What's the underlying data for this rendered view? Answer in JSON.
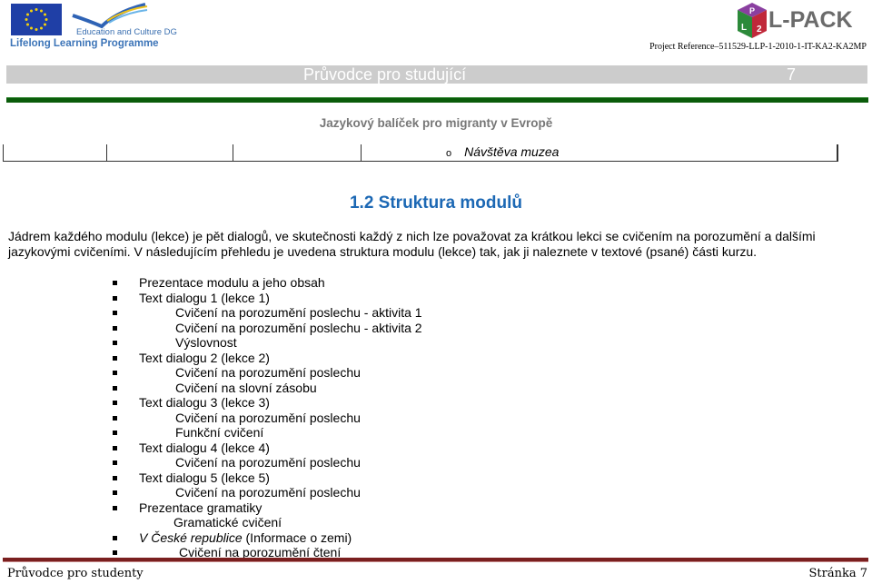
{
  "header": {
    "eu_logo": {
      "org": "Education and Culture DG",
      "programme": "Lifelong Learning Programme",
      "flag_color": "#1f3fa6"
    },
    "lpack_logo": {
      "text": "L-PACK",
      "cube_letters": [
        "P",
        "L",
        "2"
      ],
      "cube_colors": [
        "#8a3fa0",
        "#2c8a3a",
        "#c0283a"
      ]
    },
    "project_reference": "Project Reference–511529-LLP-1-2010-1-IT-KA2-KA2MP"
  },
  "band": {
    "title": "Průvodce pro studující",
    "page_number": "7",
    "band_color": "#cccccc",
    "rule_color": "#0a5c0a"
  },
  "subtitle": "Jazykový balíček pro migranty v Evropě",
  "table_fragment": {
    "item_marker": "o",
    "item_text": "Návštěva muzea"
  },
  "section": {
    "heading": "1.2 Struktura modulů",
    "heading_color": "#1c68b4",
    "paragraph": "Jádrem každého modulu (lekce) je pět dialogů, ve skutečnosti každý z nich lze považovat za krátkou lekci se cvičením na porozumění a dalšími jazykovými cvičeními. V následujícím přehledu je uvedena struktura modulu (lekce) tak, jak ji naleznete v textové (psané) části kurzu."
  },
  "outline": [
    {
      "text": "Prezentace modulu a jeho obsah",
      "level": 1,
      "bullet": true
    },
    {
      "text": "Text dialogu 1 (lekce 1)",
      "level": 1,
      "bullet": true
    },
    {
      "text": "Cvičení na porozumění poslechu - aktivita 1",
      "level": 2,
      "bullet": true
    },
    {
      "text": "Cvičení na porozumění poslechu  - aktivita 2",
      "level": 2,
      "bullet": true
    },
    {
      "text": "Výslovnost",
      "level": 2,
      "bullet": true
    },
    {
      "text": "Text dialogu 2 (lekce 2)",
      "level": 1,
      "bullet": true
    },
    {
      "text": "Cvičení na porozumění poslechu",
      "level": 2,
      "bullet": true
    },
    {
      "text": "Cvičení na slovní zásobu",
      "level": 2,
      "bullet": true
    },
    {
      "text": "Text dialogu 3 (lekce 3)",
      "level": 1,
      "bullet": true
    },
    {
      "text": "Cvičení na porozumění poslechu",
      "level": 2,
      "bullet": true
    },
    {
      "text": "Funkční cvičení",
      "level": 2,
      "bullet": true
    },
    {
      "text": "Text dialogu 4 (lekce 4)",
      "level": 1,
      "bullet": true
    },
    {
      "text": "Cvičení na porozumění poslechu",
      "level": 2,
      "bullet": true
    },
    {
      "text": "Text dialogu 5 (lekce 5)",
      "level": 1,
      "bullet": true
    },
    {
      "text": "Cvičení na porozumění poslechu",
      "level": 2,
      "bullet": true
    },
    {
      "text": "Prezentace gramatiky",
      "level": 1,
      "bullet": true
    },
    {
      "text": "Gramatické cvičení",
      "level": 2,
      "bullet": false
    },
    {
      "text": "V České republice",
      "suffix": " (Informace o zemi)",
      "italic": true,
      "level": 1,
      "bullet": true
    },
    {
      "text": "Cvičení na porozumění čtení",
      "level": 2,
      "bullet": true
    }
  ],
  "footer": {
    "left": "Průvodce pro studenty",
    "right": "Stránka 7",
    "rule_color": "#7a1f1f"
  }
}
